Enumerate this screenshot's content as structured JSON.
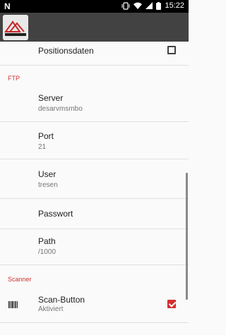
{
  "status_bar": {
    "notification_icon": "N",
    "time": "15:22",
    "icons": [
      "vibrate-icon",
      "wifi-icon",
      "signal-icon",
      "battery-icon"
    ]
  },
  "app_bar": {
    "logo": "app-logo"
  },
  "top_item": {
    "title": "Positionsdaten",
    "checked": false
  },
  "sections": {
    "ftp": "FTP",
    "scanner": "Scanner"
  },
  "ftp_items": [
    {
      "title": "Server",
      "value": "desarvmsmbo"
    },
    {
      "title": "Port",
      "value": "21"
    },
    {
      "title": "User",
      "value": "tresen"
    },
    {
      "title": "Passwort",
      "value": ""
    },
    {
      "title": "Path",
      "value": "/1000"
    }
  ],
  "scanner_items": [
    {
      "title": "Scan-Button",
      "value": "Aktiviert",
      "checked": true,
      "icon": "barcode-icon"
    }
  ],
  "colors": {
    "accent": "#d32f2f",
    "app_bar": "#424242"
  }
}
